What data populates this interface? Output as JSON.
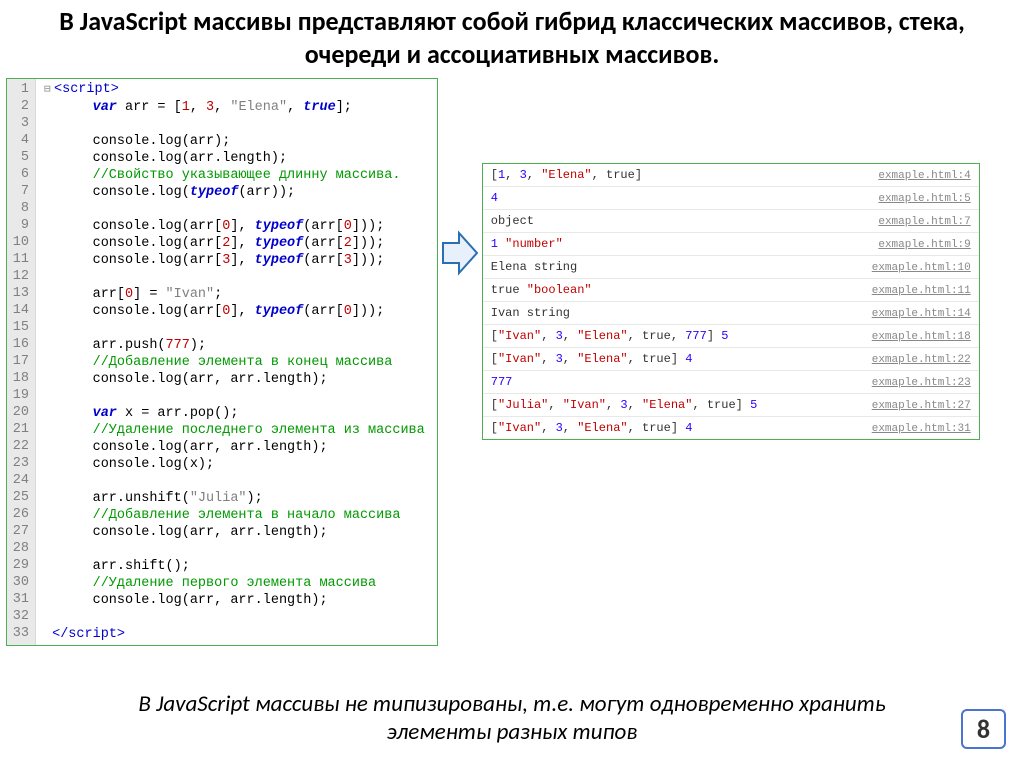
{
  "title": "В JavaScript массивы представляют собой гибрид классических массивов, стека, очереди и ассоциативных массивов.",
  "footer": "В JavaScript массивы не типизированы, т.е. могут одновременно хранить элементы разных типов",
  "page_number": "8",
  "code": {
    "lines": [
      {
        "n": "1",
        "html": "<span class='fold'>⊟</span><span class='tag'>&lt;script&gt;</span>"
      },
      {
        "n": "2",
        "html": "      <span class='kw'>var</span><span class='plain'> arr = [</span><span class='num'>1</span><span class='plain'>, </span><span class='num'>3</span><span class='plain'>, </span><span class='str'>\"Elena\"</span><span class='plain'>, </span><span class='kw'>true</span><span class='plain'>];</span>"
      },
      {
        "n": "3",
        "html": ""
      },
      {
        "n": "4",
        "html": "      <span class='plain'>console.log(arr);</span>"
      },
      {
        "n": "5",
        "html": "      <span class='plain'>console.log(arr.length);</span>"
      },
      {
        "n": "6",
        "html": "      <span class='com'>//Свойство указывающее длинну массива.</span>"
      },
      {
        "n": "7",
        "html": "      <span class='plain'>console.log(</span><span class='typeof'>typeof</span><span class='plain'>(arr));</span>"
      },
      {
        "n": "8",
        "html": ""
      },
      {
        "n": "9",
        "html": "      <span class='plain'>console.log(arr[</span><span class='num'>0</span><span class='plain'>], </span><span class='typeof'>typeof</span><span class='plain'>(arr[</span><span class='num'>0</span><span class='plain'>]));</span>"
      },
      {
        "n": "10",
        "html": "      <span class='plain'>console.log(arr[</span><span class='num'>2</span><span class='plain'>], </span><span class='typeof'>typeof</span><span class='plain'>(arr[</span><span class='num'>2</span><span class='plain'>]));</span>"
      },
      {
        "n": "11",
        "html": "      <span class='plain'>console.log(arr[</span><span class='num'>3</span><span class='plain'>], </span><span class='typeof'>typeof</span><span class='plain'>(arr[</span><span class='num'>3</span><span class='plain'>]));</span>"
      },
      {
        "n": "12",
        "html": ""
      },
      {
        "n": "13",
        "html": "      <span class='plain'>arr[</span><span class='num'>0</span><span class='plain'>] = </span><span class='str'>\"Ivan\"</span><span class='plain'>;</span>"
      },
      {
        "n": "14",
        "html": "      <span class='plain'>console.log(arr[</span><span class='num'>0</span><span class='plain'>], </span><span class='typeof'>typeof</span><span class='plain'>(arr[</span><span class='num'>0</span><span class='plain'>]));</span>"
      },
      {
        "n": "15",
        "html": ""
      },
      {
        "n": "16",
        "html": "      <span class='plain'>arr.push(</span><span class='num'>777</span><span class='plain'>);</span>"
      },
      {
        "n": "17",
        "html": "      <span class='com'>//Добавление элемента в конец массива</span>"
      },
      {
        "n": "18",
        "html": "      <span class='plain'>console.log(arr, arr.length);</span>"
      },
      {
        "n": "19",
        "html": ""
      },
      {
        "n": "20",
        "html": "      <span class='kw'>var</span><span class='plain'> x = arr.pop();</span>"
      },
      {
        "n": "21",
        "html": "      <span class='com'>//Удаление последнего элемента из массива</span>"
      },
      {
        "n": "22",
        "html": "      <span class='plain'>console.log(arr, arr.length);</span>"
      },
      {
        "n": "23",
        "html": "      <span class='plain'>console.log(x);</span>"
      },
      {
        "n": "24",
        "html": ""
      },
      {
        "n": "25",
        "html": "      <span class='plain'>arr.unshift(</span><span class='str'>\"Julia\"</span><span class='plain'>);</span>"
      },
      {
        "n": "26",
        "html": "      <span class='com'>//Добавление элемента в начало массива</span>"
      },
      {
        "n": "27",
        "html": "      <span class='plain'>console.log(arr, arr.length);</span>"
      },
      {
        "n": "28",
        "html": ""
      },
      {
        "n": "29",
        "html": "      <span class='plain'>arr.shift();</span>"
      },
      {
        "n": "30",
        "html": "      <span class='com'>//Удаление первого элемента массива</span>"
      },
      {
        "n": "31",
        "html": "      <span class='plain'>console.log(arr, arr.length);</span>"
      },
      {
        "n": "32",
        "html": ""
      },
      {
        "n": "33",
        "html": " <span class='tag'>&lt;/script&gt;</span>"
      }
    ]
  },
  "console": {
    "rows": [
      {
        "out": "<span class='c-arr'>[<span class='c-num'>1</span>, <span class='c-num'>3</span>, <span class='c-str'>\"Elena\"</span>, true]</span>",
        "src": "exmaple.html:4"
      },
      {
        "out": "<span class='c-num'>4</span>",
        "src": "exmaple.html:5"
      },
      {
        "out": "<span class='c-plain'>object</span>",
        "src": "exmaple.html:7"
      },
      {
        "out": "<span class='c-num'>1</span> <span class='c-str'>\"number\"</span>",
        "src": "exmaple.html:9"
      },
      {
        "out": "<span class='c-plain'>Elena string</span>",
        "src": "exmaple.html:10"
      },
      {
        "out": "<span class='c-plain'>true </span><span class='c-bool'>\"boolean\"</span>",
        "src": "exmaple.html:11"
      },
      {
        "out": "<span class='c-plain'>Ivan string</span>",
        "src": "exmaple.html:14"
      },
      {
        "out": "<span class='c-arr'>[<span class='c-str'>\"Ivan\"</span>, <span class='c-num'>3</span>, <span class='c-str'>\"Elena\"</span>, true, <span class='c-num'>777</span>]</span> <span class='c-num'>5</span>",
        "src": "exmaple.html:18"
      },
      {
        "out": "<span class='c-arr'>[<span class='c-str'>\"Ivan\"</span>, <span class='c-num'>3</span>, <span class='c-str'>\"Elena\"</span>, true]</span> <span class='c-num'>4</span>",
        "src": "exmaple.html:22"
      },
      {
        "out": "<span class='c-num'>777</span>",
        "src": "exmaple.html:23"
      },
      {
        "out": "<span class='c-arr'>[<span class='c-str'>\"Julia\"</span>, <span class='c-str'>\"Ivan\"</span>, <span class='c-num'>3</span>, <span class='c-str'>\"Elena\"</span>, true]</span> <span class='c-num'>5</span>",
        "src": "exmaple.html:27"
      },
      {
        "out": "<span class='c-arr'>[<span class='c-str'>\"Ivan\"</span>, <span class='c-num'>3</span>, <span class='c-str'>\"Elena\"</span>, true]</span> <span class='c-num'>4</span>",
        "src": "exmaple.html:31"
      }
    ]
  }
}
